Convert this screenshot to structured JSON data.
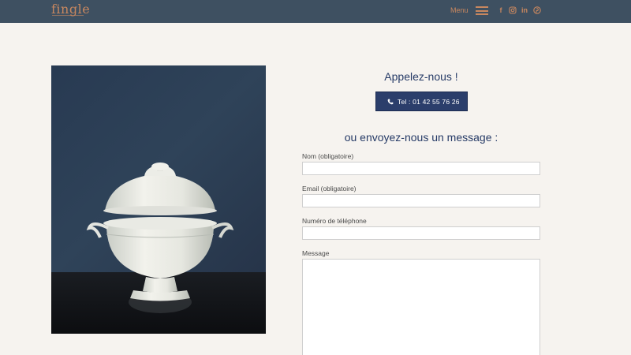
{
  "brand": {
    "logo_text": "fingle",
    "accent_color": "#c8875f",
    "header_bg": "#3e5061"
  },
  "header": {
    "menu_label": "Menu",
    "social": [
      {
        "icon": "facebook-icon",
        "glyph": "f"
      },
      {
        "icon": "instagram-icon",
        "glyph": ""
      },
      {
        "icon": "linkedin-icon",
        "glyph": "in"
      },
      {
        "icon": "pinterest-icon",
        "glyph": ""
      }
    ]
  },
  "contact": {
    "call_title": "Appelez-nous !",
    "call_button_label": "Tel : 01 42 55 76 26",
    "message_title": "ou envoyez-nous un message :"
  },
  "form": {
    "fields": [
      {
        "label": "Nom (obligatoire)",
        "value": ""
      },
      {
        "label": "Email (obligatoire)",
        "value": ""
      },
      {
        "label": "Numéro de téléphone",
        "value": ""
      },
      {
        "label": "Message",
        "value": ""
      }
    ]
  }
}
